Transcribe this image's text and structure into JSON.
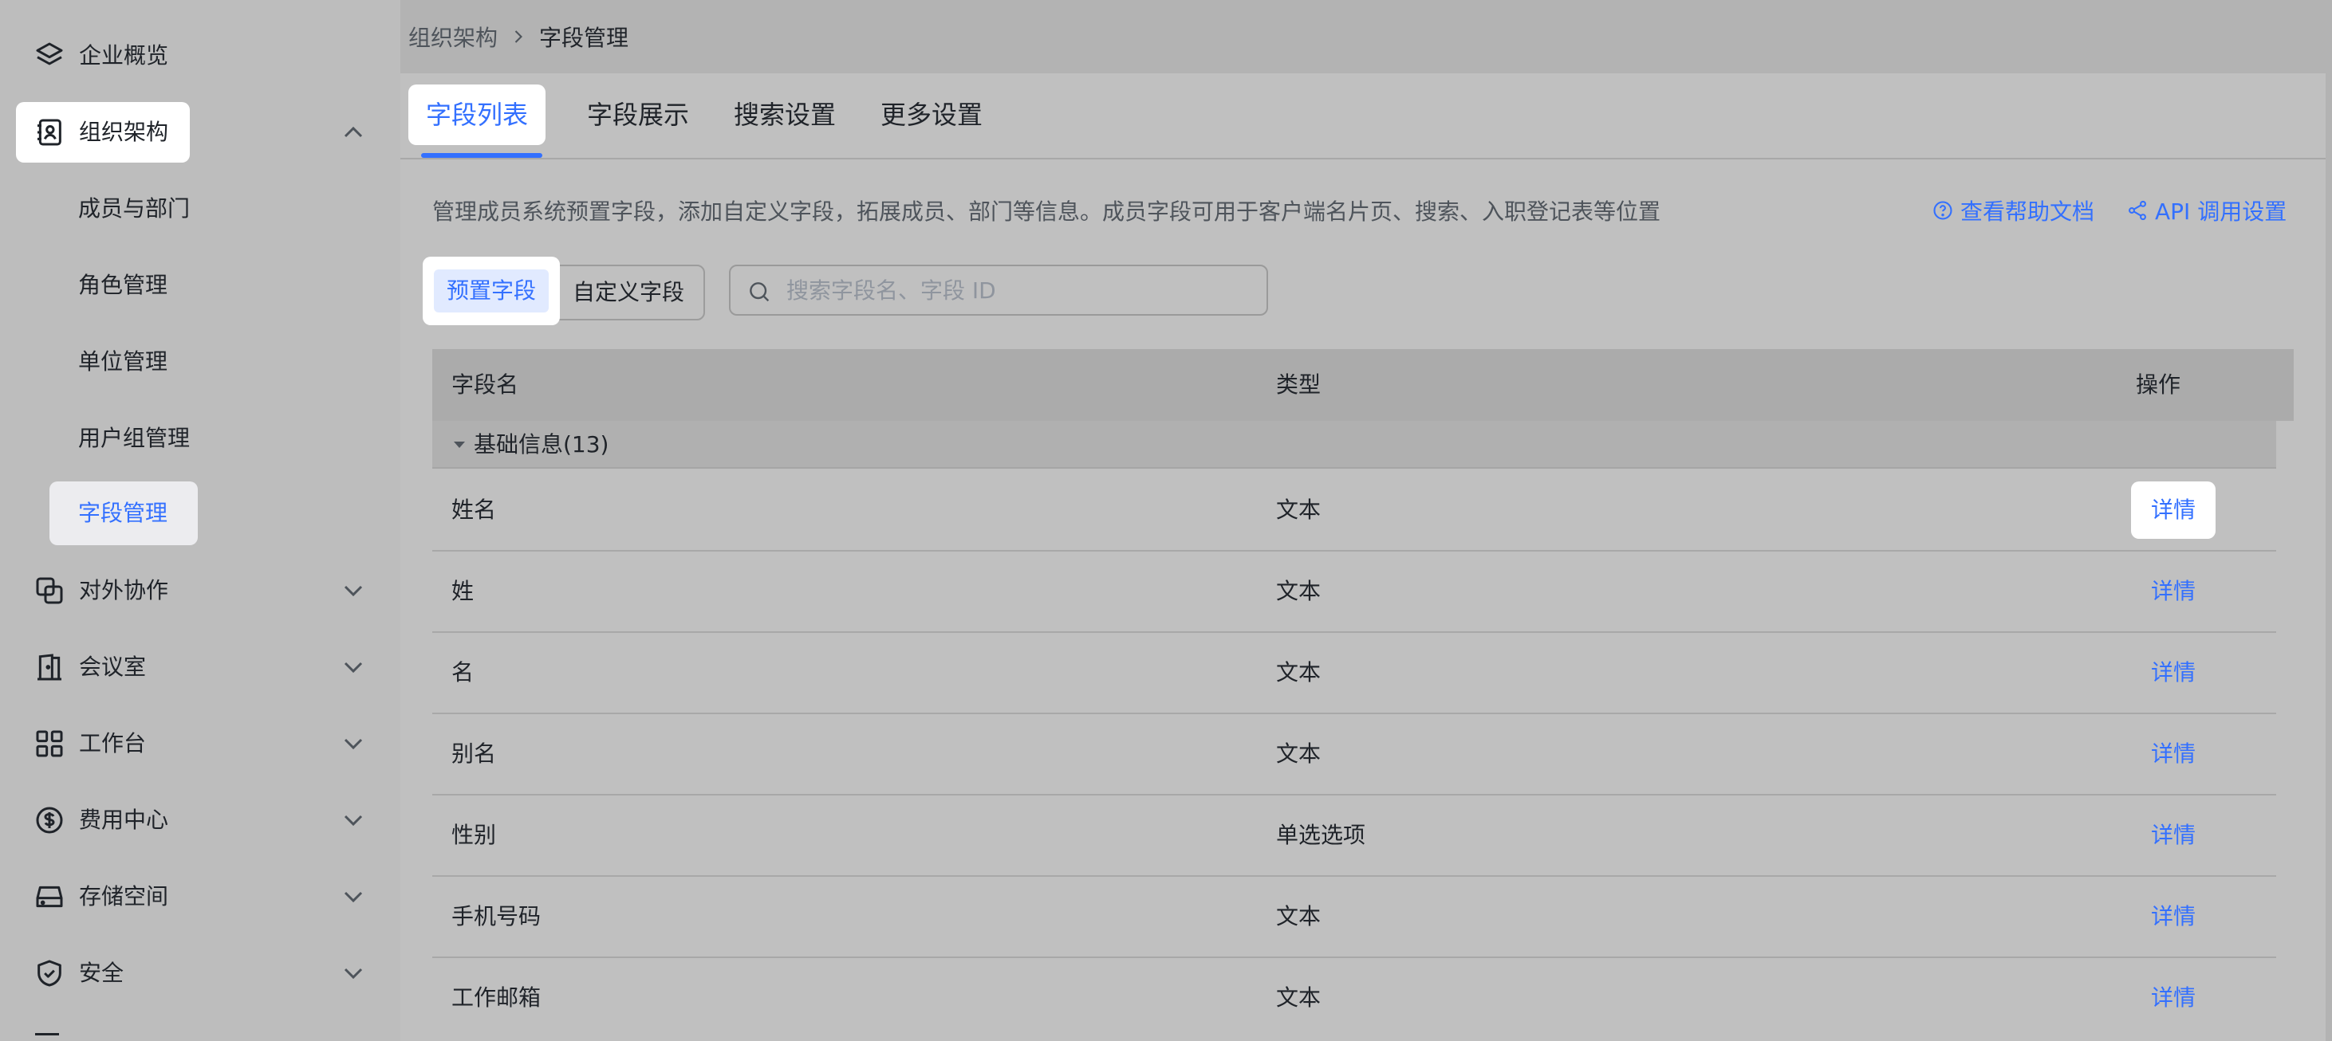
{
  "sidebar": {
    "items": [
      {
        "label": "企业概览",
        "icon": "layers-icon"
      },
      {
        "label": "组织架构",
        "icon": "contacts-book-icon"
      },
      {
        "label": "对外协作",
        "icon": "link-squares-icon"
      },
      {
        "label": "会议室",
        "icon": "door-icon"
      },
      {
        "label": "工作台",
        "icon": "grid-icon"
      },
      {
        "label": "费用中心",
        "icon": "dollar-circle-icon"
      },
      {
        "label": "存储空间",
        "icon": "hard-drive-icon"
      },
      {
        "label": "安全",
        "icon": "shield-check-icon"
      }
    ],
    "sub_items": [
      "成员与部门",
      "角色管理",
      "单位管理",
      "用户组管理",
      "字段管理"
    ],
    "active_sub": "字段管理"
  },
  "breadcrumb": {
    "parent": "组织架构",
    "current": "字段管理"
  },
  "tabs": [
    "字段列表",
    "字段展示",
    "搜索设置",
    "更多设置"
  ],
  "active_tab": "字段列表",
  "description": "管理成员系统预置字段，添加自定义字段，拓展成员、部门等信息。成员字段可用于客户端名片页、搜索、入职登记表等位置",
  "links": {
    "help": "查看帮助文档",
    "api": "API 调用设置"
  },
  "segment": {
    "preset": "预置字段",
    "custom": "自定义字段"
  },
  "search": {
    "placeholder": "搜索字段名、字段 ID",
    "value": ""
  },
  "table": {
    "headers": {
      "name": "字段名",
      "type": "类型",
      "op": "操作"
    },
    "group": "基础信息(13)",
    "rows": [
      {
        "name": "姓名",
        "type": "文本",
        "op": "详情"
      },
      {
        "name": "姓",
        "type": "文本",
        "op": "详情"
      },
      {
        "name": "名",
        "type": "文本",
        "op": "详情"
      },
      {
        "name": "别名",
        "type": "文本",
        "op": "详情"
      },
      {
        "name": "性别",
        "type": "单选选项",
        "op": "详情"
      },
      {
        "name": "手机号码",
        "type": "文本",
        "op": "详情"
      },
      {
        "name": "工作邮箱",
        "type": "文本",
        "op": "详情"
      }
    ]
  },
  "colors": {
    "accent": "#3370ff",
    "text": "#1f2329",
    "secondary": "#4e545b"
  }
}
